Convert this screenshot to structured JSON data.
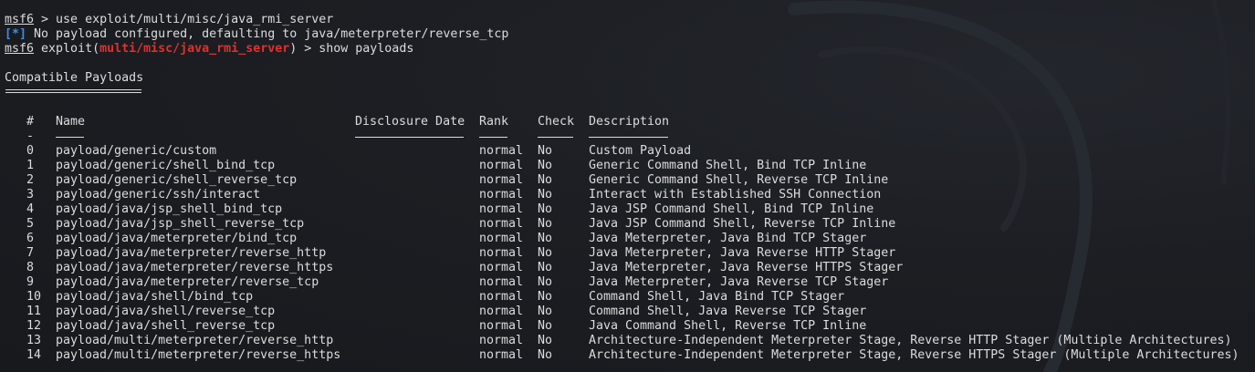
{
  "terminal": {
    "prompt": "msf6",
    "line1_cmd": " > use exploit/multi/misc/java_rmi_server",
    "info_tag": "[*]",
    "info_msg": " No payload configured, defaulting to java/meterpreter/reverse_tcp",
    "line3_pre": " exploit(",
    "line3_module": "multi/misc/java_rmi_server",
    "line3_post": ") > show payloads",
    "section_title": "Compatible Payloads",
    "colors": {
      "blue": "#3b8eea",
      "red": "#e0312c",
      "text": "#dcdcdc"
    }
  },
  "table": {
    "headers": {
      "num": "#",
      "name": "Name",
      "date": "Disclosure Date",
      "rank": "Rank",
      "check": "Check",
      "desc": "Description"
    },
    "dash_short": "-",
    "rows": [
      {
        "num": "0",
        "name": "payload/generic/custom",
        "date": "",
        "rank": "normal",
        "check": "No",
        "desc": "Custom Payload"
      },
      {
        "num": "1",
        "name": "payload/generic/shell_bind_tcp",
        "date": "",
        "rank": "normal",
        "check": "No",
        "desc": "Generic Command Shell, Bind TCP Inline"
      },
      {
        "num": "2",
        "name": "payload/generic/shell_reverse_tcp",
        "date": "",
        "rank": "normal",
        "check": "No",
        "desc": "Generic Command Shell, Reverse TCP Inline"
      },
      {
        "num": "3",
        "name": "payload/generic/ssh/interact",
        "date": "",
        "rank": "normal",
        "check": "No",
        "desc": "Interact with Established SSH Connection"
      },
      {
        "num": "4",
        "name": "payload/java/jsp_shell_bind_tcp",
        "date": "",
        "rank": "normal",
        "check": "No",
        "desc": "Java JSP Command Shell, Bind TCP Inline"
      },
      {
        "num": "5",
        "name": "payload/java/jsp_shell_reverse_tcp",
        "date": "",
        "rank": "normal",
        "check": "No",
        "desc": "Java JSP Command Shell, Reverse TCP Inline"
      },
      {
        "num": "6",
        "name": "payload/java/meterpreter/bind_tcp",
        "date": "",
        "rank": "normal",
        "check": "No",
        "desc": "Java Meterpreter, Java Bind TCP Stager"
      },
      {
        "num": "7",
        "name": "payload/java/meterpreter/reverse_http",
        "date": "",
        "rank": "normal",
        "check": "No",
        "desc": "Java Meterpreter, Java Reverse HTTP Stager"
      },
      {
        "num": "8",
        "name": "payload/java/meterpreter/reverse_https",
        "date": "",
        "rank": "normal",
        "check": "No",
        "desc": "Java Meterpreter, Java Reverse HTTPS Stager"
      },
      {
        "num": "9",
        "name": "payload/java/meterpreter/reverse_tcp",
        "date": "",
        "rank": "normal",
        "check": "No",
        "desc": "Java Meterpreter, Java Reverse TCP Stager"
      },
      {
        "num": "10",
        "name": "payload/java/shell/bind_tcp",
        "date": "",
        "rank": "normal",
        "check": "No",
        "desc": "Command Shell, Java Bind TCP Stager"
      },
      {
        "num": "11",
        "name": "payload/java/shell/reverse_tcp",
        "date": "",
        "rank": "normal",
        "check": "No",
        "desc": "Command Shell, Java Reverse TCP Stager"
      },
      {
        "num": "12",
        "name": "payload/java/shell_reverse_tcp",
        "date": "",
        "rank": "normal",
        "check": "No",
        "desc": "Java Command Shell, Reverse TCP Inline"
      },
      {
        "num": "13",
        "name": "payload/multi/meterpreter/reverse_http",
        "date": "",
        "rank": "normal",
        "check": "No",
        "desc": "Architecture-Independent Meterpreter Stage, Reverse HTTP Stager (Multiple Architectures)"
      },
      {
        "num": "14",
        "name": "payload/multi/meterpreter/reverse_https",
        "date": "",
        "rank": "normal",
        "check": "No",
        "desc": "Architecture-Independent Meterpreter Stage, Reverse HTTPS Stager (Multiple Architectures)"
      }
    ]
  }
}
